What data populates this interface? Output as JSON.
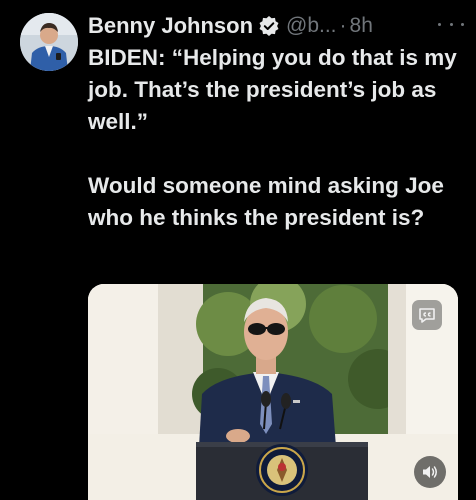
{
  "tweet": {
    "author_name": "Benny Johnson",
    "handle": "@b...",
    "separator": "·",
    "time": "8h",
    "verified": true,
    "text": "BIDEN: “Helping you do that is my job. That’s the president’s job as well.”\n\nWould someone mind asking Joe who he thinks the president is?"
  },
  "media": {
    "type": "video",
    "captions_icon": "closed-captions-icon",
    "sound_icon": "speaker-icon"
  },
  "icons": {
    "verified": "verified-badge-icon",
    "more": "more-options-icon"
  },
  "colors": {
    "background": "#000000",
    "text_primary": "#e7e9ea",
    "text_secondary": "#71767b",
    "verified_fill": "#e7e9ea"
  }
}
